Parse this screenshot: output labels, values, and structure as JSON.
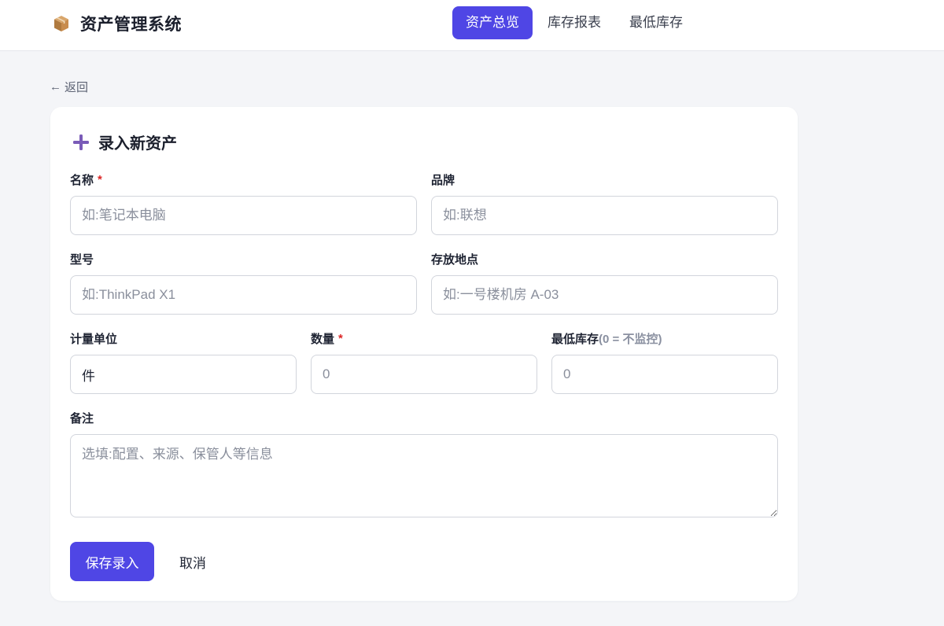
{
  "app": {
    "title": "资产管理系统",
    "icon": "package-icon"
  },
  "nav": {
    "items": [
      {
        "label": "资产总览",
        "active": true
      },
      {
        "label": "库存报表",
        "active": false
      },
      {
        "label": "最低库存",
        "active": false
      }
    ]
  },
  "back": {
    "arrow": "←",
    "label": "返回"
  },
  "form": {
    "title": "录入新资产",
    "title_icon": "plus-icon",
    "fields": {
      "name": {
        "label": "名称",
        "required_mark": "*",
        "placeholder": "如:笔记本电脑",
        "value": ""
      },
      "brand": {
        "label": "品牌",
        "placeholder": "如:联想",
        "value": ""
      },
      "model": {
        "label": "型号",
        "placeholder": "如:ThinkPad X1",
        "value": ""
      },
      "location": {
        "label": "存放地点",
        "placeholder": "如:一号楼机房 A-03",
        "value": ""
      },
      "unit": {
        "label": "计量单位",
        "placeholder": "",
        "value": "件"
      },
      "quantity": {
        "label": "数量",
        "required_mark": "*",
        "placeholder": "0",
        "value": ""
      },
      "min_stock": {
        "label": "最低库存",
        "hint": "(0 = 不监控)",
        "placeholder": "0",
        "value": ""
      },
      "notes": {
        "label": "备注",
        "placeholder": "选填:配置、来源、保管人等信息",
        "value": ""
      }
    },
    "save_label": "保存录入",
    "cancel_label": "取消"
  },
  "colors": {
    "accent": "#4f46e5",
    "required": "#dc2626",
    "background": "#f4f5f8",
    "card": "#ffffff"
  }
}
